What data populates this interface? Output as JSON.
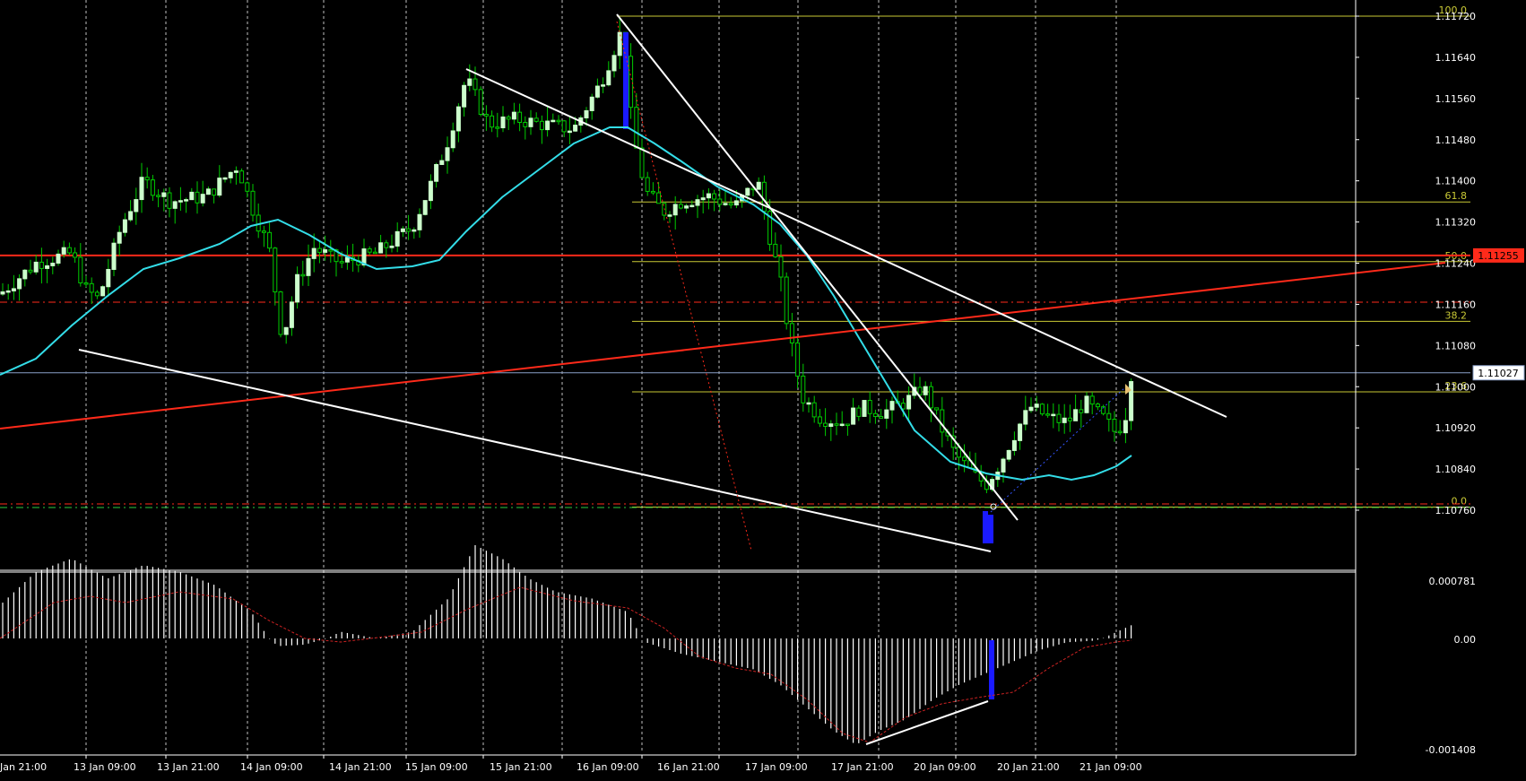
{
  "chart_data": [
    {
      "type": "candlestick",
      "title": "",
      "y_axis_ticks": [
        "1.11720",
        "1.11640",
        "1.11560",
        "1.11480",
        "1.11400",
        "1.11320",
        "1.11240",
        "1.11160",
        "1.11080",
        "1.11000",
        "1.10920",
        "1.10840",
        "1.10760"
      ],
      "ylim": [
        1.1072,
        1.11735
      ],
      "x_axis_ticks": [
        "Jan 21:00",
        "13 Jan 09:00",
        "13 Jan 21:00",
        "14 Jan 09:00",
        "14 Jan 21:00",
        "15 Jan 09:00",
        "15 Jan 21:00",
        "16 Jan 09:00",
        "16 Jan 21:00",
        "17 Jan 09:00",
        "17 Jan 21:00",
        "20 Jan 09:00",
        "20 Jan 21:00",
        "21 Jan 09:00"
      ],
      "grid": true,
      "current_price": "1.11027",
      "current_price_value": 1.11027,
      "marked_price": "1.11255",
      "marked_price_value": 1.11255,
      "fibonacci_levels": [
        {
          "label": "100.0",
          "value": 1.1172
        },
        {
          "label": "61.8",
          "value": 1.11359
        },
        {
          "label": "50.0",
          "value": 1.11243
        },
        {
          "label": "38.2",
          "value": 1.11127
        },
        {
          "label": "23.6",
          "value": 1.1099
        },
        {
          "label": "0.0",
          "value": 1.10766
        }
      ],
      "moving_average_color": "#33dde8",
      "bull_color": "#ccffcc",
      "bear_color": "#00cc00",
      "fib_color": "#c9c935",
      "trendline_color": "#ffffff",
      "support_color": "#ff2a1a"
    },
    {
      "type": "histogram",
      "title": "",
      "y_axis_ticks": [
        "0.000781",
        "0.00",
        "-0.001408"
      ],
      "ylim": [
        -0.001408,
        0.000781
      ],
      "signal_color": "#cc2222",
      "bar_color": "#ffffff",
      "highlight_color": "#1a1aff"
    }
  ]
}
